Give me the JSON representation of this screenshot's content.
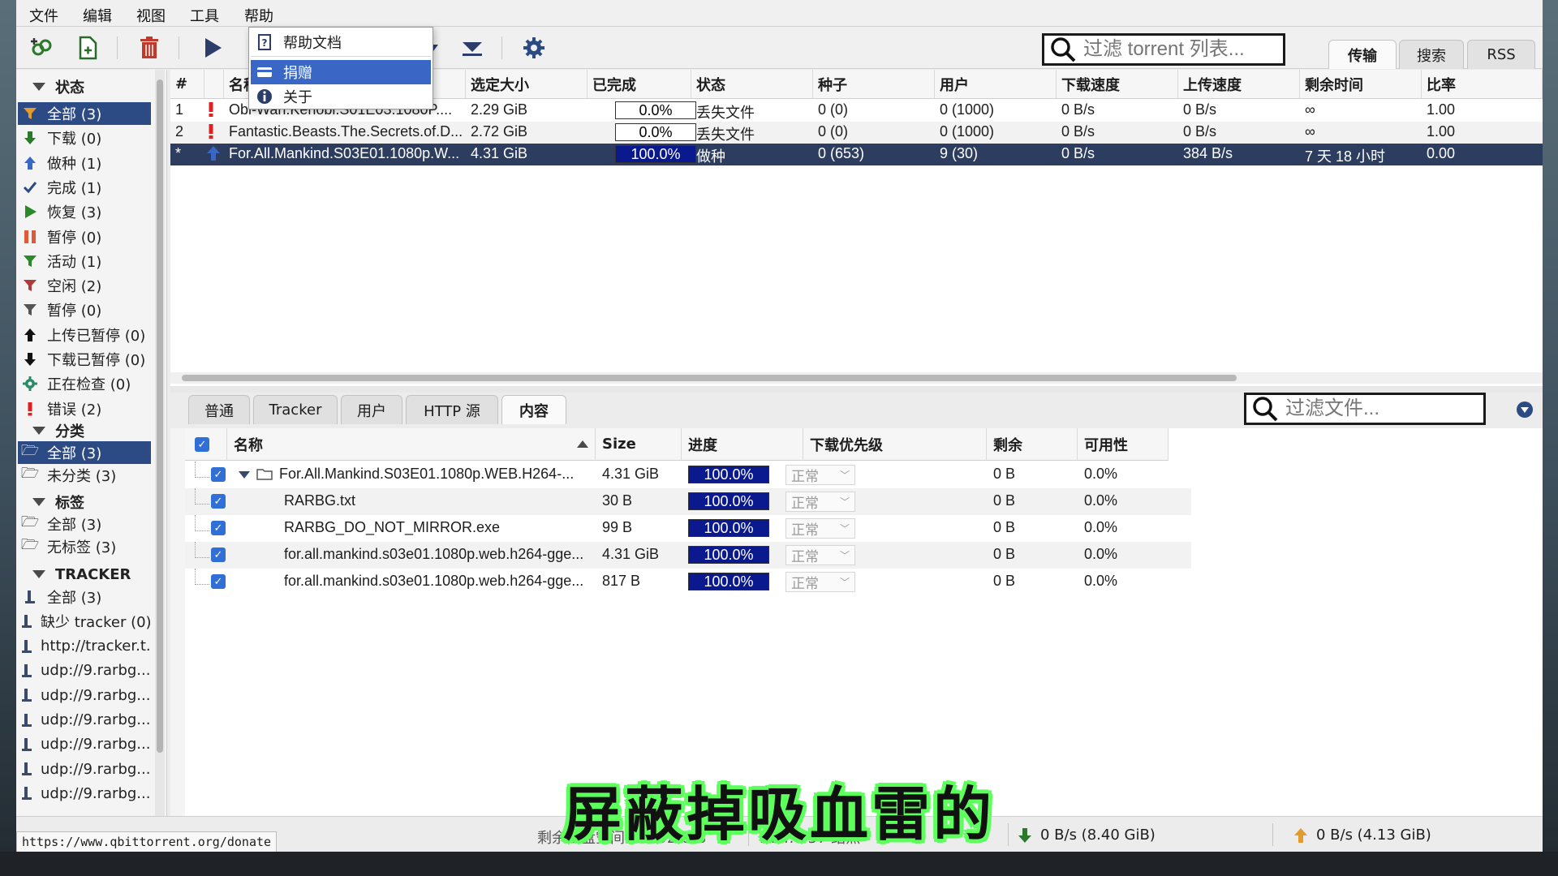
{
  "menu": [
    "文件",
    "编辑",
    "视图",
    "工具",
    "帮助"
  ],
  "help_menu": [
    {
      "label": "帮助文档",
      "icon": "help-doc-icon",
      "selected": false
    },
    {
      "label": "捐赠",
      "icon": "card-icon",
      "selected": true
    },
    {
      "label": "关于",
      "icon": "info-icon",
      "selected": false
    }
  ],
  "toolbar": {
    "search_placeholder": "过滤 torrent 列表..."
  },
  "main_tabs": [
    {
      "label": "传输",
      "active": true
    },
    {
      "label": "搜索",
      "active": false
    },
    {
      "label": "RSS",
      "active": false
    }
  ],
  "sidebar": {
    "status_header": "状态",
    "status": [
      {
        "label": "全部 (3)",
        "icon": "filter-icon",
        "selected": true
      },
      {
        "label": "下载 (0)",
        "icon": "download-arrow-icon"
      },
      {
        "label": "做种 (1)",
        "icon": "upload-arrow-icon"
      },
      {
        "label": "完成 (1)",
        "icon": "checkmark-icon"
      },
      {
        "label": "恢复 (3)",
        "icon": "play-icon"
      },
      {
        "label": "暂停 (0)",
        "icon": "pause-icon"
      },
      {
        "label": "活动 (1)",
        "icon": "filter-green-icon"
      },
      {
        "label": "空闲 (2)",
        "icon": "filter-red-icon"
      },
      {
        "label": "暂停 (0)",
        "icon": "filter-gray-icon"
      },
      {
        "label": "上传已暂停 (0)",
        "icon": "upload-paused-icon"
      },
      {
        "label": "下载已暂停 (0)",
        "icon": "download-paused-icon"
      },
      {
        "label": "正在检查 (0)",
        "icon": "gear-check-icon"
      },
      {
        "label": "错误 (2)",
        "icon": "error-icon"
      }
    ],
    "category_header": "分类",
    "categories": [
      {
        "label": "全部 (3)",
        "selected": true
      },
      {
        "label": "未分类 (3)",
        "selected": false
      }
    ],
    "tags_header": "标签",
    "tags": [
      "全部 (3)",
      "无标签 (3)"
    ],
    "tracker_header": "TRACKER",
    "trackers": [
      "全部 (3)",
      "缺少 tracker (0)",
      "http://tracker.t...",
      "udp://9.rarbg....",
      "udp://9.rarbg....",
      "udp://9.rarbg....",
      "udp://9.rarbg....",
      "udp://9.rarbg....",
      "udp://9.rarbg...."
    ]
  },
  "torrent_columns": [
    "#",
    "",
    "名称",
    "选定大小",
    "已完成",
    "状态",
    "种子",
    "用户",
    "下载速度",
    "上传速度",
    "剩余时间",
    "比率"
  ],
  "torrents": [
    {
      "num": "1",
      "status_icon": "error-icon",
      "name": "Obi-Wan.Kenobi.S01E03.1080P....",
      "size": "2.29 GiB",
      "progress": 0.0,
      "progress_text": "0.0%",
      "state": "丢失文件",
      "seeds": "0 (0)",
      "peers": "0 (1000)",
      "down": "0 B/s",
      "up": "0 B/s",
      "eta": "∞",
      "ratio": "1.00"
    },
    {
      "num": "2",
      "status_icon": "error-icon",
      "name": "Fantastic.Beasts.The.Secrets.of.D...",
      "size": "2.72 GiB",
      "progress": 0.0,
      "progress_text": "0.0%",
      "state": "丢失文件",
      "seeds": "0 (0)",
      "peers": "0 (1000)",
      "down": "0 B/s",
      "up": "0 B/s",
      "eta": "∞",
      "ratio": "1.00"
    },
    {
      "num": "*",
      "status_icon": "upload-arrow-icon",
      "name": "For.All.Mankind.S03E01.1080p.W...",
      "size": "4.31 GiB",
      "progress": 1.0,
      "progress_text": "100.0%",
      "state": "做种",
      "seeds": "0 (653)",
      "peers": "9 (30)",
      "down": "0 B/s",
      "up": "384 B/s",
      "eta": "7 天 18 小时",
      "ratio": "0.00"
    }
  ],
  "properties_tabs": [
    {
      "label": "普通",
      "active": false
    },
    {
      "label": "Tracker",
      "active": false
    },
    {
      "label": "用户",
      "active": false
    },
    {
      "label": "HTTP 源",
      "active": false
    },
    {
      "label": "内容",
      "active": true
    }
  ],
  "file_filter_placeholder": "过滤文件...",
  "file_columns": [
    "名称",
    "Size",
    "进度",
    "下载优先级",
    "剩余",
    "可用性"
  ],
  "files": [
    {
      "name": "For.All.Mankind.S03E01.1080p.WEB.H264-...",
      "folder": true,
      "size": "4.31 GiB",
      "progress": 1.0,
      "progress_text": "100.0%",
      "priority": "正常",
      "remaining": "0 B",
      "availability": "0.0%"
    },
    {
      "name": "RARBG.txt",
      "folder": false,
      "size": "30 B",
      "progress": 1.0,
      "progress_text": "100.0%",
      "priority": "正常",
      "remaining": "0 B",
      "availability": "0.0%"
    },
    {
      "name": "RARBG_DO_NOT_MIRROR.exe",
      "folder": false,
      "size": "99 B",
      "progress": 1.0,
      "progress_text": "100.0%",
      "priority": "正常",
      "remaining": "0 B",
      "availability": "0.0%"
    },
    {
      "name": "for.all.mankind.s03e01.1080p.web.h264-gge...",
      "folder": false,
      "size": "4.31 GiB",
      "progress": 1.0,
      "progress_text": "100.0%",
      "priority": "正常",
      "remaining": "0 B",
      "availability": "0.0%"
    },
    {
      "name": "for.all.mankind.s03e01.1080p.web.h264-gge...",
      "folder": false,
      "size": "817 B",
      "progress": 1.0,
      "progress_text": "100.0%",
      "priority": "正常",
      "remaining": "0 B",
      "availability": "0.0%"
    }
  ],
  "statusbar": {
    "url": "https://www.qbittorrent.org/donate",
    "free_space": "剩余磁盘空间: 26.92 GiB",
    "dht": "DHT: 357 结点",
    "download": "0 B/s (8.40 GiB)",
    "upload": "0 B/s (4.13 GiB)"
  },
  "subtitle": "屏蔽掉吸血雷的",
  "colors": {
    "selection": "#2c4a83",
    "progress_fill": "#0a1a8e",
    "menu_highlight": "#3a66c6",
    "subtitle_outline": "#5cff5c"
  }
}
